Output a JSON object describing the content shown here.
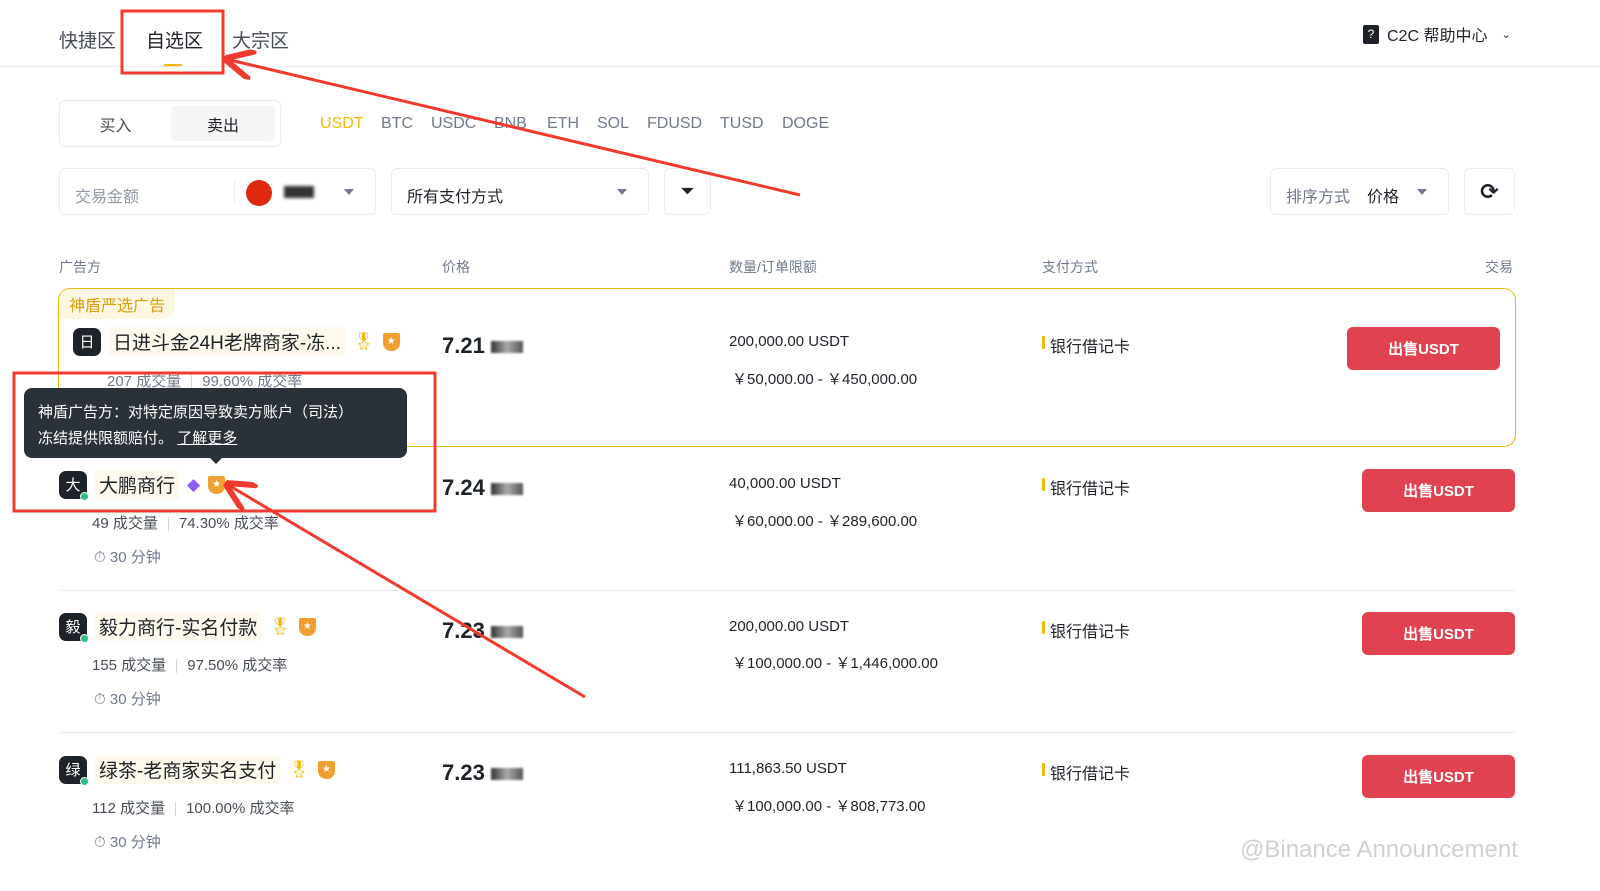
{
  "tabs": [
    "快捷区",
    "自选区",
    "大宗区"
  ],
  "help": {
    "label": "C2C 帮助中心"
  },
  "trade_toggle": {
    "buy": "买入",
    "sell": "卖出"
  },
  "coins": [
    "USDT",
    "BTC",
    "USDC",
    "BNB",
    "ETH",
    "SOL",
    "FDUSD",
    "TUSD",
    "DOGE"
  ],
  "filters": {
    "amount_placeholder": "交易金额",
    "payment": "所有支付方式",
    "sort_label": "排序方式",
    "sort_value": "价格"
  },
  "columns": [
    "广告方",
    "价格",
    "数量/订单限额",
    "支付方式",
    "交易"
  ],
  "featured_label": "神盾严选广告",
  "tooltip": {
    "text_line1": "神盾广告方：对特定原因导致卖方账户（司法）",
    "text_line2": "冻结提供限额赔付。",
    "link": "了解更多"
  },
  "ads": [
    {
      "avatar": "日",
      "name": "日进斗金24H老牌商家-冻...",
      "orders": "207 成交量",
      "rate": "99.60% 成交率",
      "price": "7.21",
      "qty": "200,000.00 USDT",
      "limit": "￥50,000.00 - ￥450,000.00",
      "payment": "银行借记卡",
      "button": "出售USDT"
    },
    {
      "avatar": "大",
      "name": "大鹏商行",
      "orders": "49 成交量",
      "rate": "74.30% 成交率",
      "time": "30 分钟",
      "price": "7.24",
      "qty": "40,000.00 USDT",
      "limit": "￥60,000.00 - ￥289,600.00",
      "payment": "银行借记卡",
      "button": "出售USDT"
    },
    {
      "avatar": "毅",
      "name": "毅力商行-实名付款",
      "orders": "155 成交量",
      "rate": "97.50% 成交率",
      "time": "30 分钟",
      "price": "7.23",
      "qty": "200,000.00 USDT",
      "limit": "￥100,000.00 - ￥1,446,000.00",
      "payment": "银行借记卡",
      "button": "出售USDT"
    },
    {
      "avatar": "绿",
      "name": "绿茶-老商家实名支付",
      "orders": "112 成交量",
      "rate": "100.00% 成交率",
      "time": "30 分钟",
      "price": "7.23",
      "qty": "111,863.50 USDT",
      "limit": "￥100,000.00 - ￥808,773.00",
      "payment": "银行借记卡",
      "button": "出售USDT"
    }
  ],
  "watermark": "@Binance Announcement",
  "colors": {
    "accent": "#f0b90b",
    "sell": "#e0424f",
    "annotation": "#f03a2e"
  }
}
